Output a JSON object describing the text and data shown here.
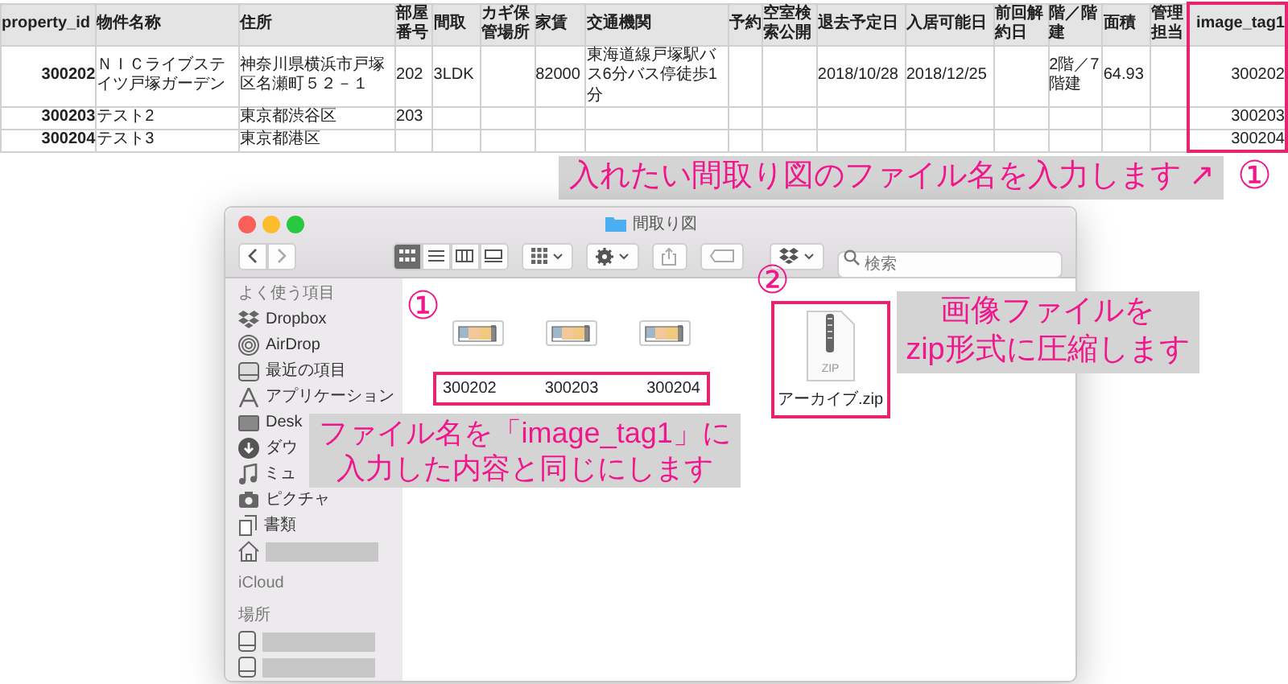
{
  "spreadsheet": {
    "columns": [
      {
        "label": "property_id",
        "highlighted": false
      },
      {
        "label": "物件名称",
        "highlighted": false
      },
      {
        "label": "住所",
        "highlighted": false
      },
      {
        "label": "部屋番号",
        "highlighted": false
      },
      {
        "label": "間取",
        "highlighted": false
      },
      {
        "label": "カギ保管場所",
        "highlighted": false
      },
      {
        "label": "家賃",
        "highlighted": false
      },
      {
        "label": "交通機関",
        "highlighted": false
      },
      {
        "label": "予約",
        "highlighted": false
      },
      {
        "label": "空室検索公開",
        "highlighted": false
      },
      {
        "label": "退去予定日",
        "highlighted": false
      },
      {
        "label": "入居可能日",
        "highlighted": false
      },
      {
        "label": "前回解約日",
        "highlighted": false
      },
      {
        "label": "階／階建",
        "highlighted": false
      },
      {
        "label": "面積",
        "highlighted": false
      },
      {
        "label": "管理担当",
        "highlighted": false
      },
      {
        "label": "image_tag1",
        "highlighted": true
      }
    ],
    "rows": [
      [
        "300202",
        "ＮＩＣライブステイツ戸塚ガーデン",
        "神奈川県横浜市戸塚区名瀬町５２－１",
        "202",
        "3LDK",
        null,
        "82000",
        "東海道線戸塚駅バス6分バス停徒歩1分",
        null,
        null,
        "2018/10/28",
        "2018/12/25",
        null,
        "2階／7階建",
        "64.93",
        null,
        "300202"
      ],
      [
        "300203",
        "テスト2",
        "東京都渋谷区",
        "203",
        null,
        null,
        null,
        null,
        null,
        null,
        null,
        null,
        null,
        null,
        null,
        null,
        "300203"
      ],
      [
        "300204",
        "テスト3",
        "東京都港区",
        null,
        null,
        null,
        null,
        null,
        null,
        null,
        null,
        null,
        null,
        null,
        null,
        null,
        "300204"
      ]
    ]
  },
  "callout_top": {
    "text": "入れたい間取り図のファイル名を入力します ↗",
    "marker": "①"
  },
  "finder": {
    "title": "間取り図",
    "view_modes": [
      {
        "kind": "icons",
        "selected": true
      },
      {
        "kind": "list",
        "selected": false
      },
      {
        "kind": "columns",
        "selected": false
      },
      {
        "kind": "gallery",
        "selected": false
      }
    ],
    "search": {
      "placeholder": "検索"
    },
    "sidebar": [
      {
        "heading": "よく使う項目",
        "items": [
          {
            "kind": "dropbox",
            "label": "Dropbox"
          },
          {
            "kind": "airdrop",
            "label": "AirDrop"
          },
          {
            "kind": "recents",
            "label": "最近の項目"
          },
          {
            "kind": "apps",
            "label": "アプリケーション"
          },
          {
            "kind": "desktop",
            "label": "Desk"
          },
          {
            "kind": "downloads",
            "label": "ダウ"
          },
          {
            "kind": "music",
            "label": "ミュ"
          },
          {
            "kind": "pictures",
            "label": "ピクチャ"
          },
          {
            "kind": "documents",
            "label": "書類"
          },
          {
            "kind": "home",
            "redacted": true
          }
        ]
      },
      {
        "heading": "iCloud"
      },
      {
        "heading": "場所",
        "items": [
          {
            "kind": "disk",
            "redacted": true
          },
          {
            "kind": "disk",
            "redacted": true
          }
        ]
      }
    ],
    "images_marker": "①",
    "images": [
      {
        "label": "300202"
      },
      {
        "label": "300203"
      },
      {
        "label": "300204"
      }
    ],
    "zip_marker": "②",
    "zip": {
      "badge": "ZIP",
      "label": "アーカイブ.zip"
    }
  },
  "callout_zip": {
    "lines": [
      "画像ファイルを",
      "zip形式に圧縮します"
    ]
  },
  "callout_name": {
    "lines": [
      "ファイル名を「image_tag1」に",
      "入力した内容と同じにします"
    ]
  }
}
